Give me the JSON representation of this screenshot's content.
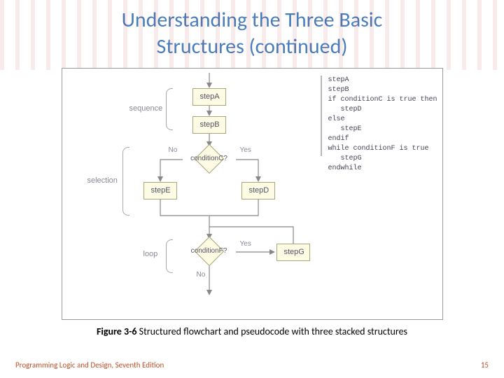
{
  "title_line1": "Understanding the Three Basic",
  "title_line2": "Structures (continued)",
  "flow": {
    "stepA": "stepA",
    "stepB": "stepB",
    "condC": "conditionC?",
    "stepD": "stepD",
    "stepE": "stepE",
    "condF": "conditionF?",
    "stepG": "stepG",
    "lbl_sequence": "sequence",
    "lbl_selection": "selection",
    "lbl_loop": "loop",
    "no": "No",
    "yes": "Yes"
  },
  "pseudocode": "stepA\nstepB\nif conditionC is true then\n   stepD\nelse\n   stepE\nendif\nwhile conditionF is true\n   stepG\nendwhile",
  "caption_prefix": "Figure 3-6",
  "caption_rest": " Structured flowchart and pseudocode with three stacked structures",
  "footer_left": "Programming Logic and Design, Seventh Edition",
  "footer_right": "15"
}
